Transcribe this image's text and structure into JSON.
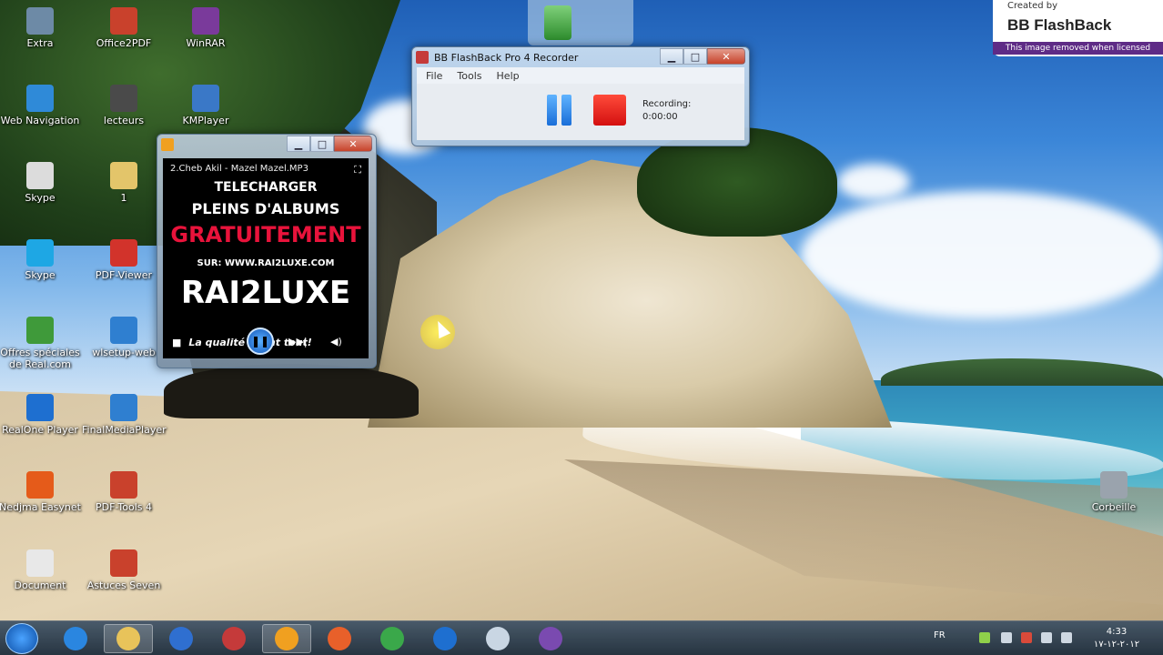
{
  "desktop_icons": [
    {
      "label": "Extra",
      "icon": "extra-icon",
      "color": "#6d8aa6"
    },
    {
      "label": "Office2PDF",
      "icon": "office2pdf-icon",
      "color": "#c9412c"
    },
    {
      "label": "WinRAR",
      "icon": "winrar-icon",
      "color": "#7a3a9b"
    },
    {
      "label": "Web Navigation",
      "icon": "web-navigation-icon",
      "color": "#2f8ad8"
    },
    {
      "label": "lecteurs",
      "icon": "lecteurs-icon",
      "color": "#4a4a4a"
    },
    {
      "label": "KMPlayer",
      "icon": "kmplayer-icon",
      "color": "#3a78c7"
    },
    {
      "label": "Skype",
      "icon": "document-icon",
      "color": "#dcdcdc"
    },
    {
      "label": "1",
      "icon": "folder-icon",
      "color": "#e3c56a"
    },
    {
      "label": "Skype",
      "icon": "skype-icon",
      "color": "#1ea7e4"
    },
    {
      "label": "PDF-Viewer",
      "icon": "pdf-viewer-icon",
      "color": "#d2332b"
    },
    {
      "label": "Offres spéciales de Real.com",
      "icon": "gift-icon",
      "color": "#3f9a3a"
    },
    {
      "label": "wlsetup-web",
      "icon": "windows-icon",
      "color": "#2f7fd0"
    },
    {
      "label": "RealOne Player",
      "icon": "realone-icon",
      "color": "#1e6fd0"
    },
    {
      "label": "FinalMediaPlayer",
      "icon": "play-icon",
      "color": "#2f7fd0"
    },
    {
      "label": "Nedjma Easynet",
      "icon": "nedjma-icon",
      "color": "#e55b1a"
    },
    {
      "label": "PDF-Tools 4",
      "icon": "pdf-tools-icon",
      "color": "#c9412c"
    },
    {
      "label": "Document",
      "icon": "document-icon",
      "color": "#e8e8e8"
    },
    {
      "label": "Astuces Seven",
      "icon": "astuces-icon",
      "color": "#c9412c"
    },
    {
      "label": "Corbeille",
      "icon": "recycle-bin-icon",
      "color": "#9aa3ad"
    }
  ],
  "recorder": {
    "title": "BB FlashBack Pro 4 Recorder",
    "menu": [
      "File",
      "Tools",
      "Help"
    ],
    "status_label": "Recording:",
    "time": "0:00:00"
  },
  "player": {
    "track": "2.Cheb Akil - Mazel Mazel.MP3",
    "poster_lines": [
      "TELECHARGER",
      "PLEINS D'ALBUMS",
      "GRATUITEMENT",
      "SUR: WWW.RAI2LUXE.COM",
      "RAI2LUXE",
      "La qualité avant tout!"
    ]
  },
  "watermark": {
    "created_by": "Created by",
    "brand": "BB FlashBack",
    "note": "This image removed when licensed"
  },
  "taskbar": {
    "apps": [
      "ie-icon",
      "explorer-icon",
      "media-player-icon",
      "paint-icon",
      "flashback-recorder-icon",
      "firefox-icon",
      "chrome-icon",
      "realone-icon",
      "window-icon",
      "flashback-icon"
    ],
    "language": "FR",
    "time": "4:33",
    "date": "٢٠١٢-١٢-١٧"
  }
}
